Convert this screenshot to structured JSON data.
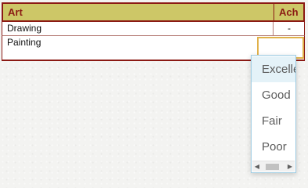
{
  "table": {
    "headers": {
      "art": "Art",
      "ach": "Ach"
    },
    "rows": [
      {
        "label": "Drawing",
        "ach": "-"
      },
      {
        "label": "Painting",
        "ach": ""
      }
    ]
  },
  "dropdown": {
    "options": [
      "Excellent",
      "Good",
      "Fair",
      "Poor"
    ],
    "highlighted_index": 0
  },
  "colors": {
    "header_background": "#cdc767",
    "border": "#8b1a14",
    "select_focus_border": "#e0b14a",
    "dropdown_border": "#9ccbe2",
    "option_highlight": "#e4f2f8"
  },
  "icons": {
    "scroll_left": "triangle-left-icon",
    "scroll_right": "triangle-right-icon"
  }
}
